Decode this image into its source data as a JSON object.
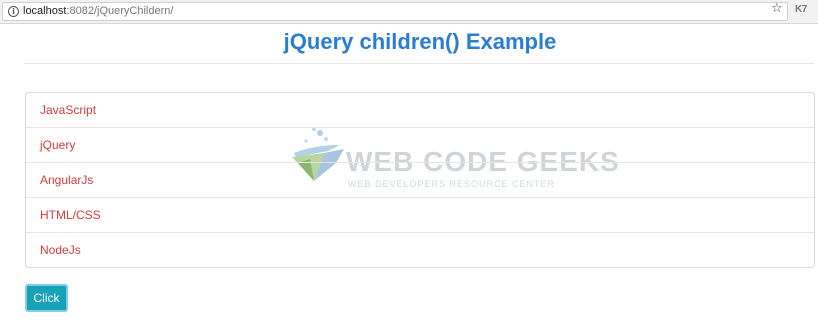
{
  "browser": {
    "url_host": "localhost",
    "url_path": ":8082/jQueryChildern/",
    "info_icon": "info-icon",
    "bookmark_icon": "star-icon",
    "extension_icon": "extension-icon",
    "extension_label": "K7"
  },
  "page": {
    "title": "jQuery children() Example",
    "title_color": "#2a7dcf"
  },
  "list": {
    "item_color": "#d23c3c",
    "items": [
      {
        "label": "JavaScript"
      },
      {
        "label": "jQuery"
      },
      {
        "label": "AngularJs"
      },
      {
        "label": "HTML/CSS"
      },
      {
        "label": "NodeJs"
      }
    ]
  },
  "watermark": {
    "title": "WEB CODE GEEKS",
    "subtitle": "WEB DEVELOPERS RESOURCE CENTER"
  },
  "actions": {
    "click_label": "Click",
    "button_color": "#17a2b8"
  }
}
